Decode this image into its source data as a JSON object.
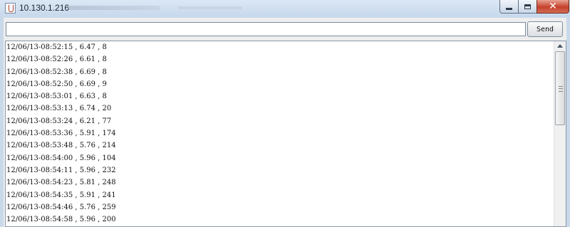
{
  "window": {
    "title": "10.130.1.216",
    "controls": [
      "minimize-icon",
      "maximize-icon",
      "close-icon"
    ]
  },
  "command": {
    "value": "",
    "send_label": "Send"
  },
  "output": {
    "lines": [
      "12/06/13-08:52:15 , 6.47 , 8",
      "12/06/13-08:52:26 , 6.61 , 8",
      "12/06/13-08:52:38 , 6.69 , 8",
      "12/06/13-08:52:50 , 6.69 , 9",
      "12/06/13-08:53:01 , 6.63 , 8",
      "12/06/13-08:53:13 , 6.74 , 20",
      "12/06/13-08:53:24 , 6.21 , 77",
      "12/06/13-08:53:36 , 5.91 , 174",
      "12/06/13-08:53:48 , 5.76 , 214",
      "12/06/13-08:54:00 , 5.96 , 104",
      "12/06/13-08:54:11 , 5.96 , 232",
      "12/06/13-08:54:23 , 5.81 , 248",
      "12/06/13-08:54:35 , 5.91 , 241",
      "12/06/13-08:54:46 , 5.76 , 259",
      "12/06/13-08:54:58 , 5.96 , 200"
    ]
  }
}
